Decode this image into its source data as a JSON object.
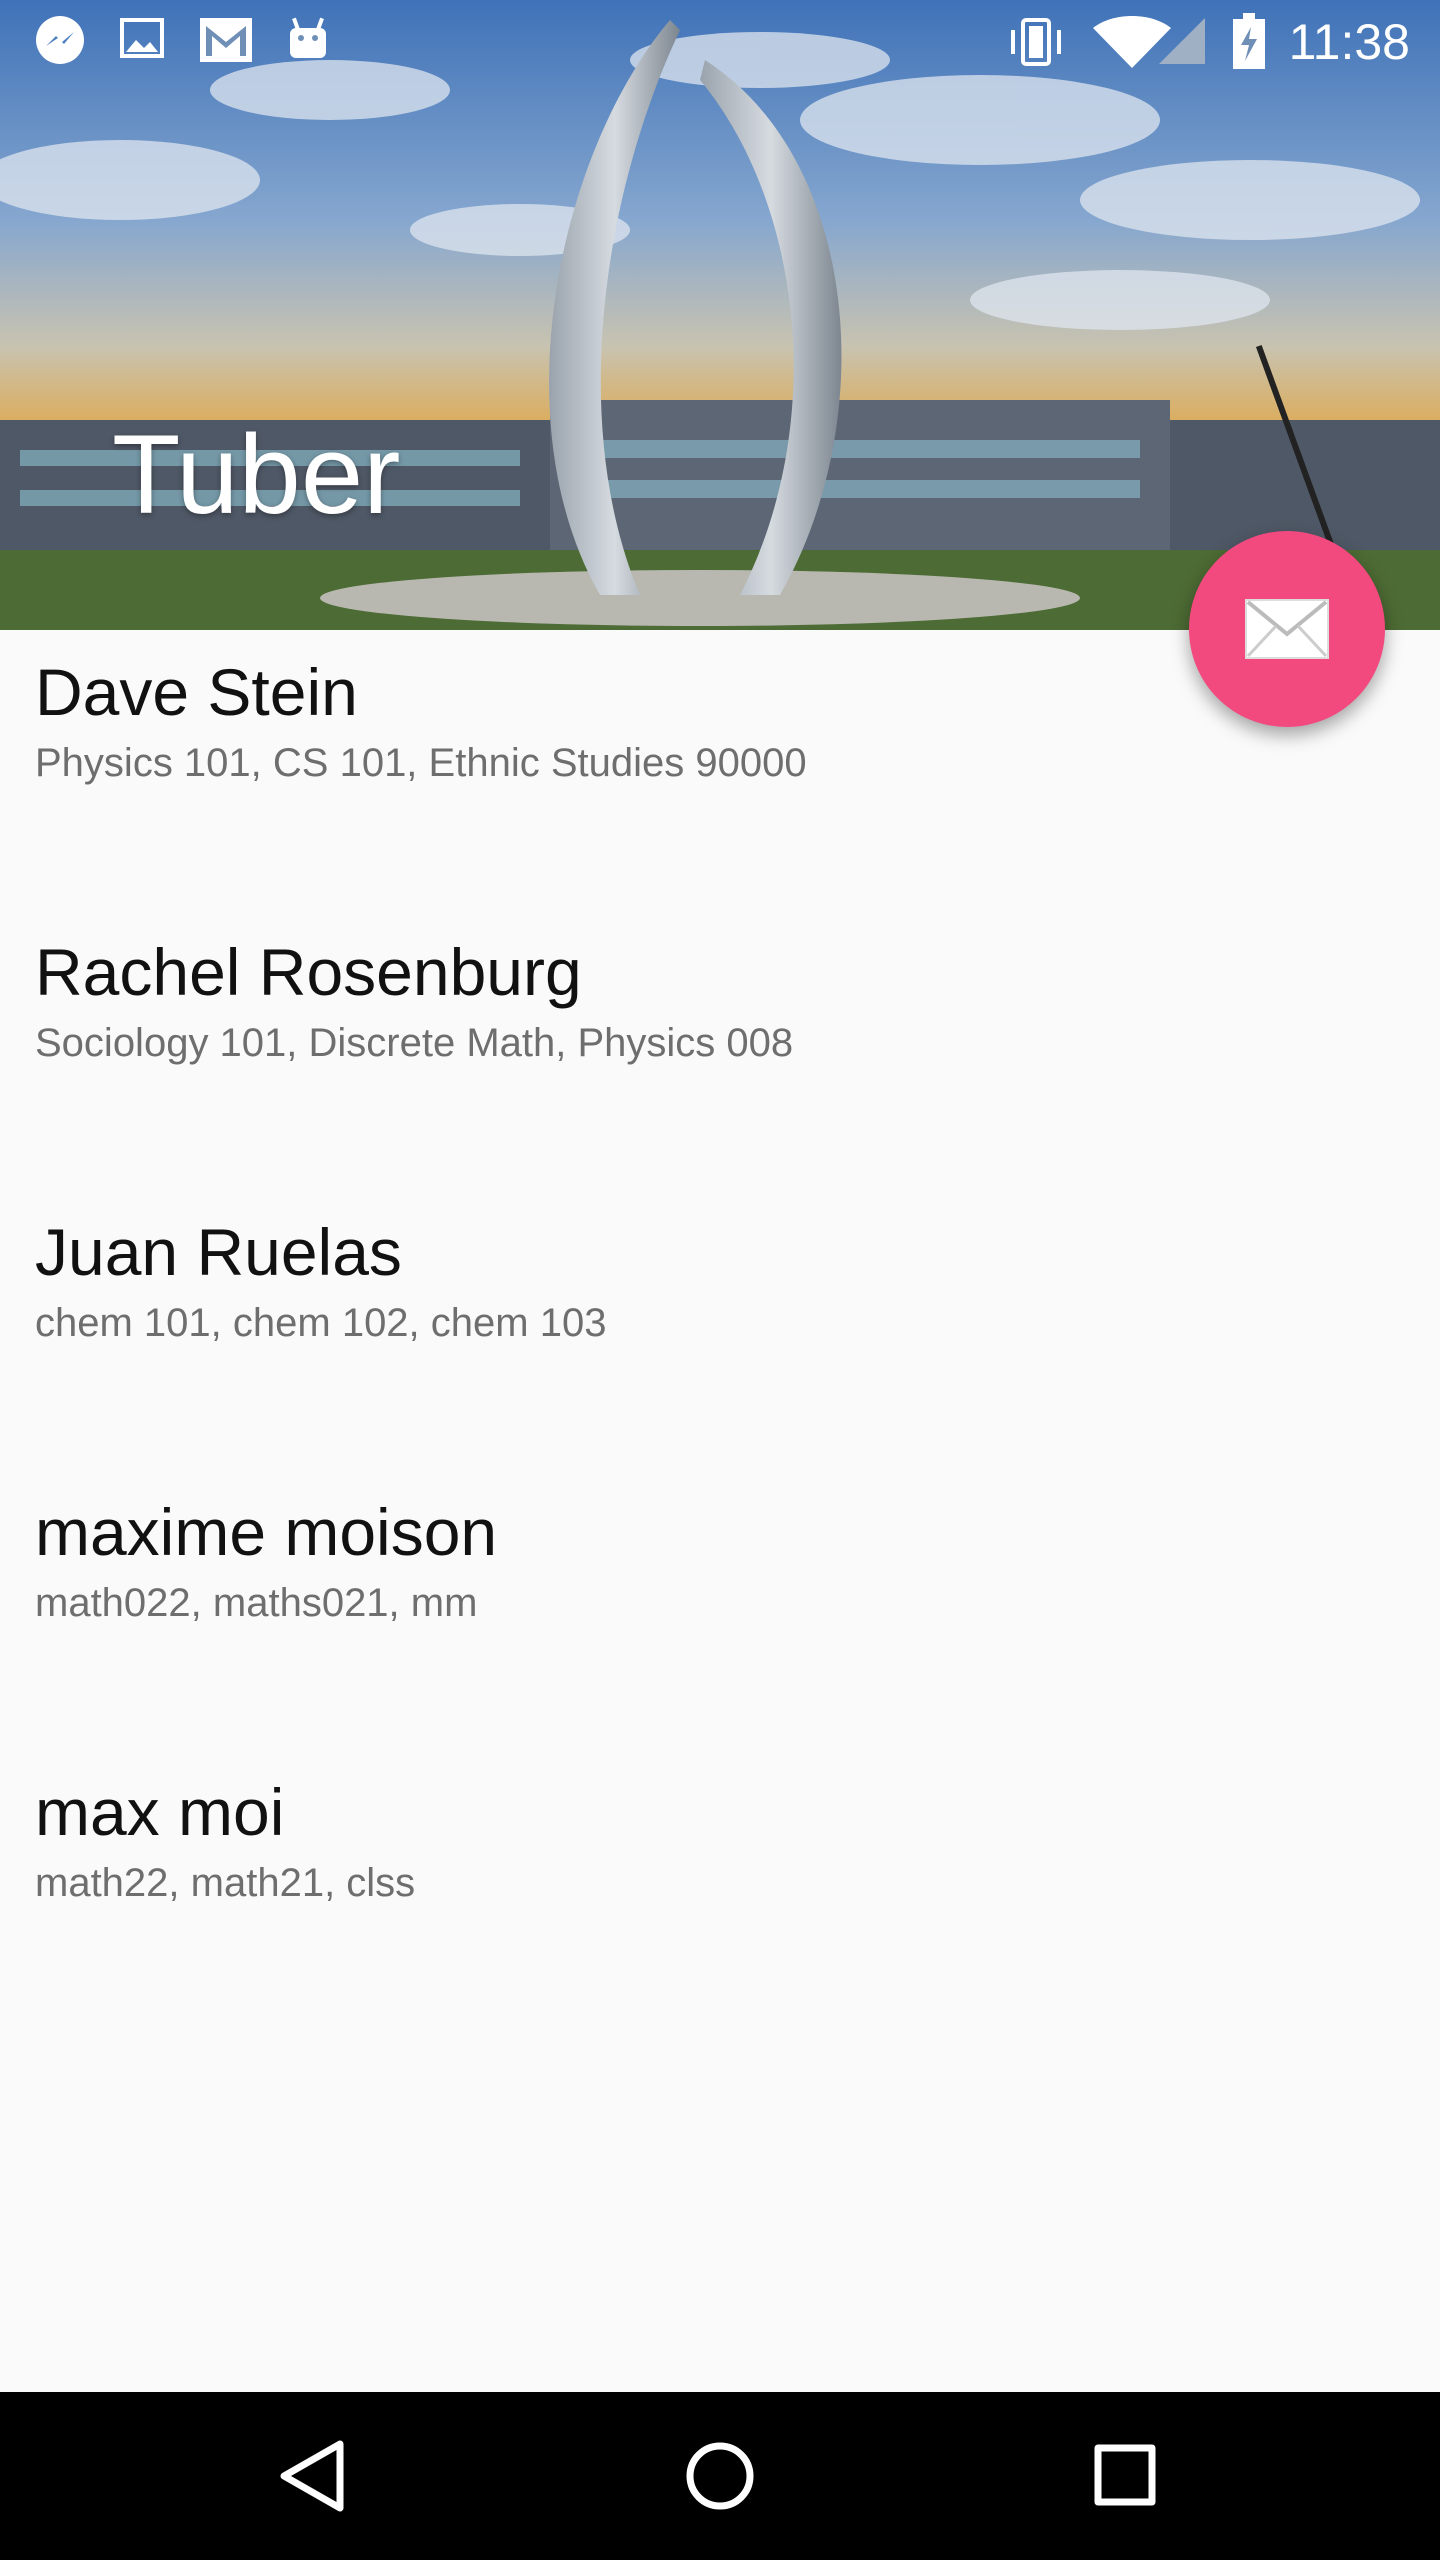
{
  "status_bar": {
    "time": "11:38",
    "left_icons": [
      "messenger-icon",
      "gallery-icon",
      "gmail-icon",
      "android-icon"
    ],
    "right_icons": [
      "vibrate-icon",
      "wifi-icon",
      "cell-signal-icon",
      "battery-charging-icon"
    ]
  },
  "header": {
    "title": "Tuber"
  },
  "fab": {
    "icon": "mail-icon",
    "color": "#f2497f"
  },
  "tutors": [
    {
      "name": "Dave Stein",
      "classes": "Physics 101, CS 101, Ethnic Studies 90000"
    },
    {
      "name": "Rachel Rosenburg",
      "classes": "Sociology 101, Discrete Math, Physics 008"
    },
    {
      "name": "Juan Ruelas",
      "classes": "chem 101, chem 102, chem 103"
    },
    {
      "name": "maxime moison",
      "classes": "math022, maths021, mm"
    },
    {
      "name": "max moi",
      "classes": "math22, math21, clss"
    }
  ],
  "nav_bar": {
    "icons": [
      "back-icon",
      "home-icon",
      "recents-icon"
    ]
  }
}
